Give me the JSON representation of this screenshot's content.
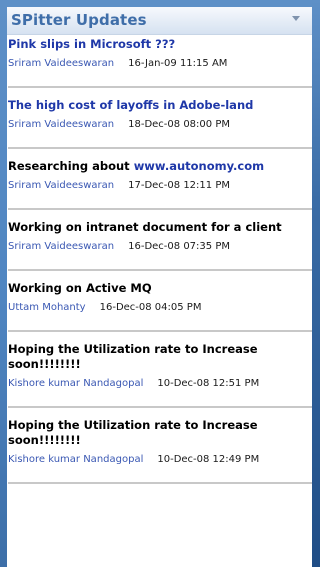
{
  "widget": {
    "title": "SPitter Updates"
  },
  "entries": [
    {
      "title": "Pink slips in Microsoft ???",
      "author": "Sriram Vaideeswaran",
      "date": "16-Jan-09 11:15 AM"
    },
    {
      "title": "The high cost of layoffs in Adobe-land",
      "author": "Sriram Vaideeswaran",
      "date": "18-Dec-08 08:00 PM"
    },
    {
      "title_prefix": "Researching about ",
      "title_link": "www.autonomy.com",
      "author": "Sriram Vaideeswaran",
      "date": "17-Dec-08 12:11 PM"
    },
    {
      "title": "Working on intranet document for a client",
      "author": "Sriram Vaideeswaran",
      "date": "16-Dec-08 07:35 PM"
    },
    {
      "title": "Working on Active MQ",
      "author": "Uttam Mohanty",
      "date": "16-Dec-08 04:05 PM"
    },
    {
      "title": "Hoping the Utilization rate to Increase soon!!!!!!!!",
      "author": "Kishore kumar Nandagopal",
      "date": "10-Dec-08 12:51 PM"
    },
    {
      "title": "Hoping the Utilization rate to Increase soon!!!!!!!!",
      "author": "Kishore kumar Nandagopal",
      "date": "10-Dec-08 12:49 PM"
    }
  ]
}
